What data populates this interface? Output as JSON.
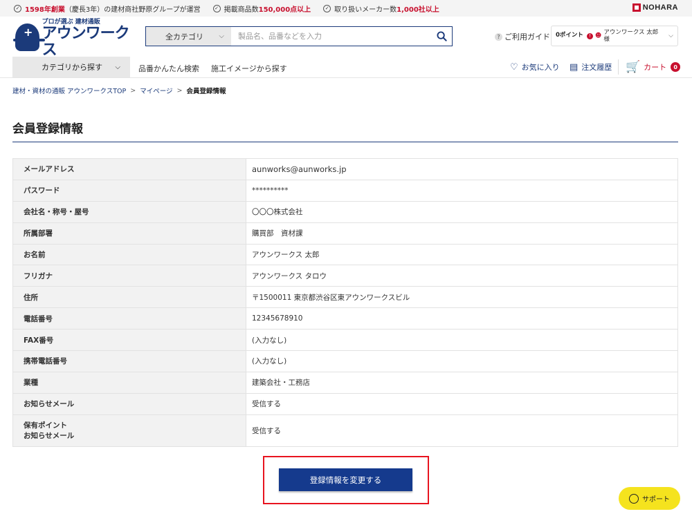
{
  "topbar": {
    "claims": [
      {
        "highlight": "1598年創業",
        "text": "（慶長3年）の建材商社野原グループが運営"
      },
      {
        "prefix": "掲載商品数",
        "highlight": "150,000点以上"
      },
      {
        "prefix": "取り扱いメーカー数",
        "highlight": "1,000社以上"
      }
    ],
    "brand": "NOHARA"
  },
  "header": {
    "logo_tagline": "プロが選ぶ 建材通販",
    "logo_name": "アウンワークス",
    "search": {
      "category": "全カテゴリ",
      "placeholder": "製品名、品番などを入力"
    },
    "guide_label": "ご利用ガイド",
    "account": {
      "points": "0ポイント",
      "user_name_line1": "アウンワークス 太郎",
      "user_name_line2": "様"
    }
  },
  "nav": {
    "category_button": "カテゴリから探す",
    "links": [
      "品番かんたん検索",
      "施工イメージから探す"
    ],
    "favorites": "お気に入り",
    "order_history": "注文履歴",
    "cart": "カート",
    "cart_count": "0"
  },
  "breadcrumb": {
    "items": [
      "建材・資材の通販 アウンワークスTOP",
      "マイページ"
    ],
    "current": "会員登録情報"
  },
  "page_title": "会員登録情報",
  "member_info": [
    {
      "label": "メールアドレス",
      "value": "aunworks@aunworks.jp"
    },
    {
      "label": "パスワード",
      "value": "**********"
    },
    {
      "label": "会社名・称号・屋号",
      "value": "〇〇〇株式会社"
    },
    {
      "label": "所属部署",
      "value": "購買部　資材課"
    },
    {
      "label": "お名前",
      "value": "アウンワークス 太郎"
    },
    {
      "label": "フリガナ",
      "value": "アウンワークス タロウ"
    },
    {
      "label": "住所",
      "value": "〒1500011 東京都渋谷区東アウンワークスビル"
    },
    {
      "label": "電話番号",
      "value": "12345678910"
    },
    {
      "label": "FAX番号",
      "value": "(入力なし)"
    },
    {
      "label": "携帯電話番号",
      "value": "(入力なし)"
    },
    {
      "label": "業種",
      "value": "建築会社・工務店"
    },
    {
      "label": "お知らせメール",
      "value": "受信する"
    },
    {
      "label_line1": "保有ポイント",
      "label_line2": "お知らせメール",
      "value": "受信する"
    }
  ],
  "edit_button": "登録情報を変更する",
  "support_button": "サポート",
  "colors": {
    "brand_navy": "#1b3a7a",
    "button_blue": "#153a8d",
    "accent_red": "#c8102e",
    "highlight_red": "#e8131f",
    "support_yellow": "#f5e31e"
  }
}
